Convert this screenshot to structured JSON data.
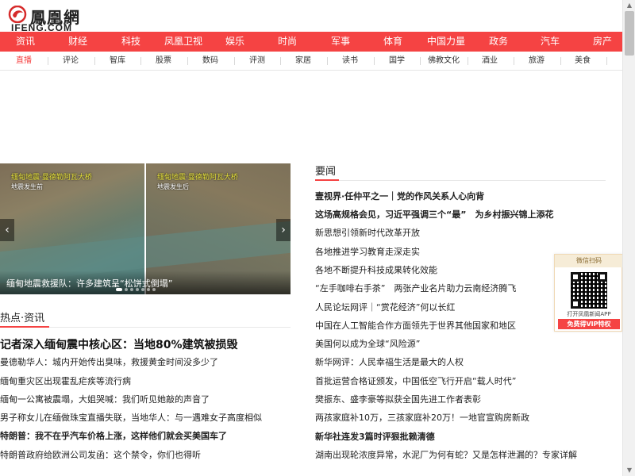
{
  "logo": {
    "cn": "鳳凰網",
    "en": "IFENG.COM"
  },
  "colors": {
    "accent": "#f54343",
    "nav_text": "#ffffff",
    "sub_active": "#f54343"
  },
  "nav_main": [
    "资讯",
    "财经",
    "科技",
    "凤凰卫视",
    "娱乐",
    "时尚",
    "军事",
    "体育",
    "中国力量",
    "政务",
    "汽车",
    "房产"
  ],
  "nav_sub": [
    "直播",
    "评论",
    "智库",
    "股票",
    "数码",
    "评测",
    "家居",
    "读书",
    "国学",
    "佛教文化",
    "酒业",
    "旅游",
    "美食"
  ],
  "slider": {
    "tag_left": "缅甸地震·曼德勒阿瓦大桥",
    "tag_left_sub": "地震发生前",
    "tag_right": "缅甸地震·曼德勒阿瓦大桥",
    "tag_right_sub": "地震发生后",
    "caption": "缅甸地震救援队：许多建筑呈“松饼式倒塌”",
    "prev": "‹",
    "next": "›"
  },
  "hot": {
    "title": "热点·资讯",
    "items": [
      "记者深入缅甸震中核心区：当地80%建筑被损毁",
      "曼德勒华人：城内开始传出臭味，救援黄金时间没多少了",
      "缅甸重灾区出现霍乱疟疾等流行病",
      "缅甸一公寓被震塌，大姐哭喊：我们听见她敲的声音了",
      "男子称女儿在缅做珠宝直播失联，当地华人：与一遇难女子高度相似",
      "特朗普：我不在乎汽车价格上涨，这样他们就会买美国车了",
      "特朗普政府给欧洲公司发函：这个禁令，你们也得听"
    ]
  },
  "news": {
    "title": "要闻",
    "items": [
      "壹视界·任仲平之一｜党的作风关系人心向背",
      "这场高规格会见，习近平强调三个“最”　为乡村振兴锦上添花",
      "新思想引领新时代改革开放",
      "各地推进学习教育走深走实",
      "各地不断提升科技成果转化效能",
      "“左手咖啡右手茶”　两张产业名片助力云南经济腾飞",
      "人民论坛网评｜“赏花经济”何以长红",
      "中国在人工智能合作方面领先于世界其他国家和地区",
      "美国何以成为全球“风险源”",
      "新华网评：人民幸福生活是最大的人权",
      "首批运营合格证颁发，中国低空飞行开启“载人时代”",
      "樊振东、盛李豪等拟获全国先进工作者表彰",
      "两孩家庭补10万，三孩家庭补20万！一地官宣购房新政",
      "新华社连发3篇时评狠批赖清德",
      "湖南出现轮浓度异常，水泥厂为何有蛇？又是怎样泄漏的？专家详解"
    ]
  },
  "qr": {
    "head": "微信扫码",
    "line1": "打开凤凰新闻APP",
    "line2": "免费得VIP特权"
  },
  "scrollbar": {
    "up": "▲",
    "down": "▼",
    "position": 0.0
  }
}
